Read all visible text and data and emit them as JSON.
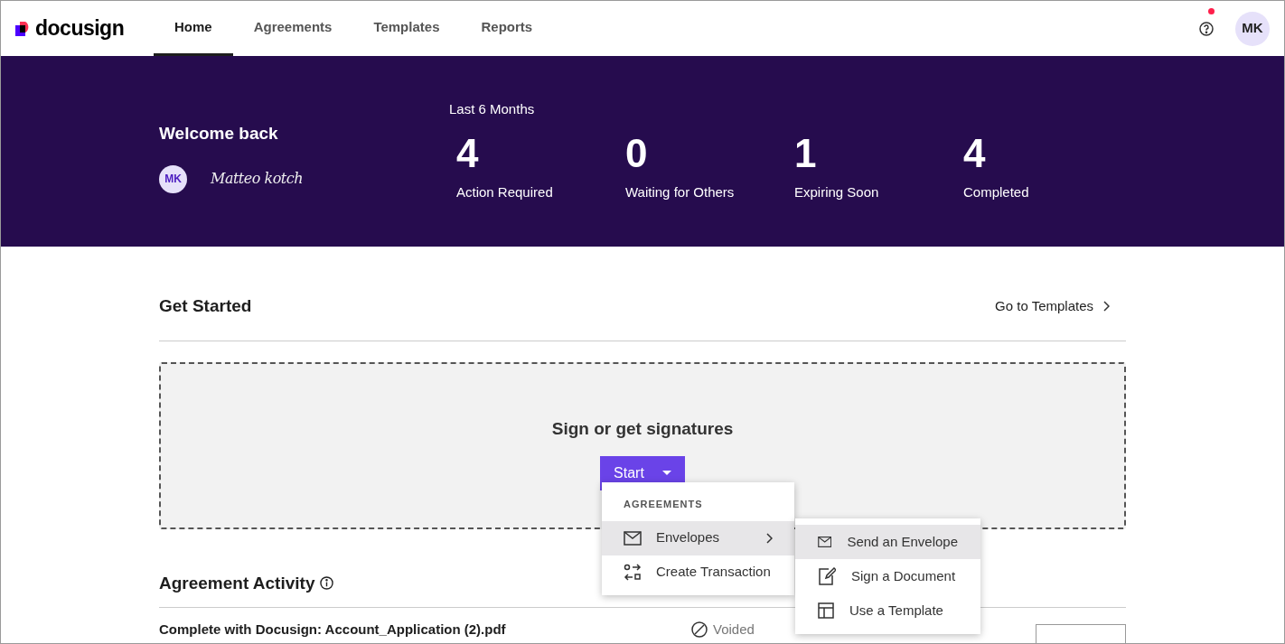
{
  "brand": {
    "name": "docusign"
  },
  "nav_tabs": [
    {
      "label": "Home",
      "selected": true
    },
    {
      "label": "Agreements",
      "selected": false
    },
    {
      "label": "Templates",
      "selected": false
    },
    {
      "label": "Reports",
      "selected": false
    }
  ],
  "header": {
    "help_notification": true,
    "avatar": "MK"
  },
  "welcome": {
    "title": "Welcome back",
    "avatar": "MK",
    "signature": "Matteo kotch"
  },
  "stats": {
    "period": "Last 6 Months",
    "items": [
      {
        "value": "4",
        "label": "Action Required"
      },
      {
        "value": "0",
        "label": "Waiting for Others"
      },
      {
        "value": "1",
        "label": "Expiring Soon"
      },
      {
        "value": "4",
        "label": "Completed"
      }
    ]
  },
  "get_started": {
    "heading": "Get Started",
    "link": "Go to Templates",
    "drop_title": "Sign or get signatures",
    "button": "Start"
  },
  "start_menu": {
    "section": "AGREEMENTS",
    "items": [
      {
        "kind": "envelope",
        "label": "Envelopes",
        "highlighted": true,
        "has_submenu": true
      },
      {
        "kind": "transaction",
        "label": "Create Transaction",
        "highlighted": false,
        "has_submenu": false
      }
    ]
  },
  "submenu": {
    "items": [
      {
        "kind": "envelope",
        "label": "Send an Envelope",
        "highlighted": true
      },
      {
        "kind": "sign",
        "label": "Sign a Document",
        "highlighted": false
      },
      {
        "kind": "template",
        "label": "Use a Template",
        "highlighted": false
      }
    ]
  },
  "activity": {
    "title": "Agreement Activity",
    "rows": [
      {
        "name": "Complete with Docusign: Account_Application (2).pdf",
        "status": "Voided"
      }
    ]
  }
}
